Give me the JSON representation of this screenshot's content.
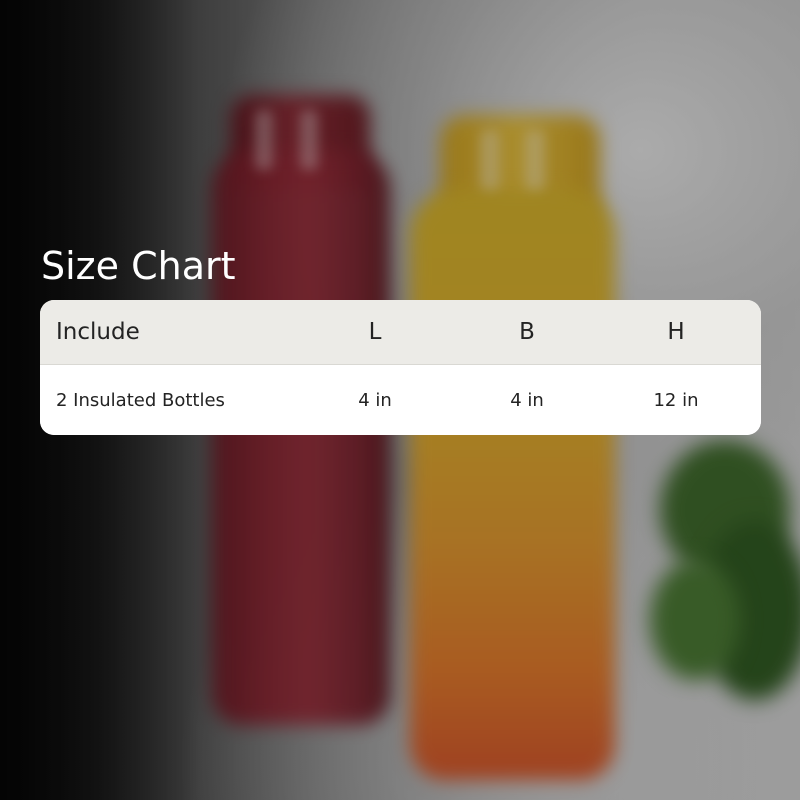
{
  "title": "Size Chart",
  "table": {
    "headers": [
      "Include",
      "L",
      "B",
      "H"
    ],
    "rows": [
      [
        "2 Insulated Bottles",
        "4 in",
        "4 in",
        "12 in"
      ]
    ]
  },
  "colors": {
    "header_bg": "#ecebe7",
    "row_bg": "#ffffff",
    "text": "#232323",
    "title": "#ffffff"
  }
}
